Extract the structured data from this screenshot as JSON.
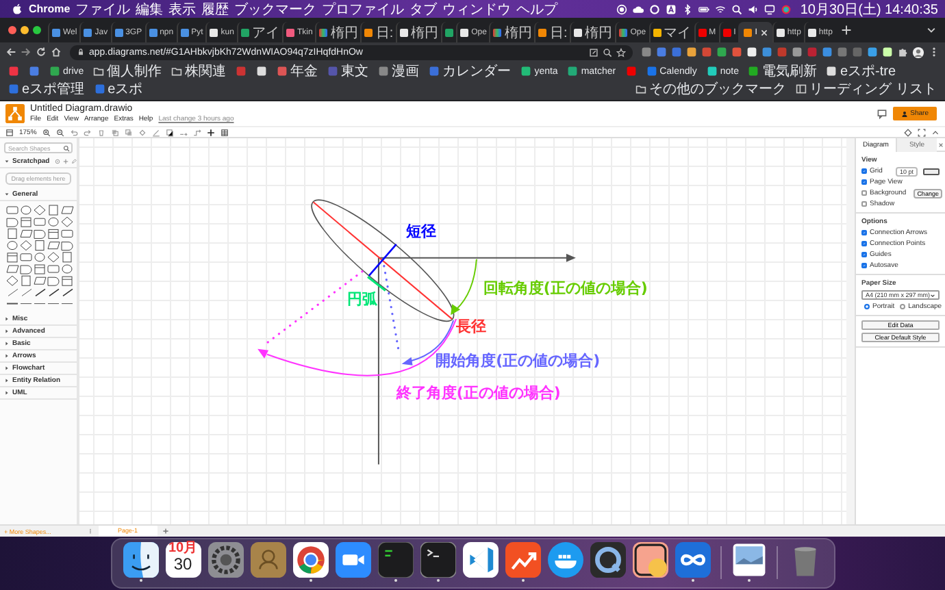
{
  "menu_bar": {
    "app": "Chrome",
    "items": [
      "ファイル",
      "編集",
      "表示",
      "履歴",
      "ブックマーク",
      "プロファイル",
      "タブ",
      "ウィンドウ",
      "ヘルプ"
    ],
    "clock": "10月30日(土) 14:40:35"
  },
  "browser": {
    "tabs": [
      {
        "label": "Wel",
        "selected": false
      },
      {
        "label": "Jav",
        "selected": false
      },
      {
        "label": "3GP",
        "selected": false
      },
      {
        "label": "npn",
        "selected": false
      },
      {
        "label": "Pyt",
        "selected": false
      },
      {
        "label": "kun",
        "selected": false
      },
      {
        "label": "アイ",
        "selected": false
      },
      {
        "label": "Tkin",
        "selected": false
      },
      {
        "label": "楕円",
        "selected": false
      },
      {
        "label": "日:",
        "selected": false
      },
      {
        "label": "楕円",
        "selected": false
      },
      {
        "selected": false
      },
      {
        "label": "Ope",
        "selected": false
      },
      {
        "label": "楕円",
        "selected": false
      },
      {
        "label": "日:",
        "selected": false
      },
      {
        "label": "楕円",
        "selected": false
      },
      {
        "label": "Ope",
        "selected": false
      },
      {
        "label": "マイ",
        "selected": false
      },
      {
        "label": "M",
        "selected": false
      },
      {
        "label": "I",
        "selected": false
      },
      {
        "label": "I",
        "selected": true
      },
      {
        "label": "http",
        "selected": false
      },
      {
        "label": "http",
        "selected": false
      }
    ],
    "address": "app.diagrams.net/#G1AHbkvjbKh72WdnWIAO94q7zIHqfdHnOw",
    "bookmarks": [
      {
        "kind": "site"
      },
      {
        "kind": "site"
      },
      {
        "kind": "site",
        "label": "drive"
      },
      {
        "kind": "folder",
        "label": "個人制作"
      },
      {
        "kind": "folder",
        "label": "株関連"
      },
      {
        "kind": "site"
      },
      {
        "kind": "site"
      },
      {
        "kind": "site",
        "label": "年金"
      },
      {
        "kind": "site",
        "label": "東文"
      },
      {
        "kind": "site",
        "label": "漫画"
      },
      {
        "kind": "site",
        "label": "カレンダー"
      },
      {
        "kind": "site",
        "label": "yenta"
      },
      {
        "kind": "site",
        "label": "matcher"
      },
      {
        "kind": "site"
      },
      {
        "kind": "site",
        "label": "Calendly"
      },
      {
        "kind": "site",
        "label": "note"
      },
      {
        "kind": "site",
        "label": "電気刷新"
      },
      {
        "kind": "site",
        "label": "eスポ-tre"
      },
      {
        "kind": "site",
        "label": "eスポ管理"
      },
      {
        "kind": "site",
        "label": "eスポ"
      }
    ],
    "other_bookmarks": "その他のブックマーク",
    "reading_list": "リーディング リスト"
  },
  "drawio": {
    "title": "Untitled Diagram.drawio",
    "menu": [
      "File",
      "Edit",
      "View",
      "Arrange",
      "Extras",
      "Help"
    ],
    "last_change": "Last change 3 hours ago",
    "share": "Share",
    "zoom": "175%"
  },
  "sidebar": {
    "search_placeholder": "Search Shapes",
    "scratchpad": "Scratchpad",
    "drop_hint": "Drag elements here",
    "sections": [
      {
        "label": "General",
        "expanded": true
      },
      {
        "label": "Misc",
        "expanded": false
      },
      {
        "label": "Advanced",
        "expanded": false
      },
      {
        "label": "Basic",
        "expanded": false
      },
      {
        "label": "Arrows",
        "expanded": false
      },
      {
        "label": "Flowchart",
        "expanded": false
      },
      {
        "label": "Entity Relation",
        "expanded": false
      },
      {
        "label": "UML",
        "expanded": false
      }
    ],
    "more_shapes": "+ More Shapes..."
  },
  "pages": [
    {
      "label": "Page-1",
      "selected": true
    }
  ],
  "format_panel": {
    "tabs": [
      {
        "label": "Diagram",
        "selected": true
      },
      {
        "label": "Style",
        "selected": false
      }
    ],
    "view_title": "View",
    "view": [
      {
        "label": "Grid",
        "checked": true,
        "value": "10 pt"
      },
      {
        "label": "Page View",
        "checked": true
      },
      {
        "label": "Background",
        "checked": false,
        "button": "Change"
      },
      {
        "label": "Shadow",
        "checked": false
      }
    ],
    "options_title": "Options",
    "options": [
      {
        "label": "Connection Arrows",
        "checked": true
      },
      {
        "label": "Connection Points",
        "checked": true
      },
      {
        "label": "Guides",
        "checked": true
      },
      {
        "label": "Autosave",
        "checked": true
      }
    ],
    "paper_title": "Paper Size",
    "paper_size": "A4 (210 mm x 297 mm)",
    "orientations": [
      {
        "label": "Portrait",
        "selected": true
      },
      {
        "label": "Landscape",
        "selected": false
      }
    ],
    "buttons": [
      "Edit Data",
      "Clear Default Style"
    ]
  },
  "diagram": {
    "labels": [
      {
        "text": "短径",
        "color": "#0000ff"
      },
      {
        "text": "回転角度(正の値の場合)",
        "color": "#66cc00"
      },
      {
        "text": "円弧",
        "color": "#00e676"
      },
      {
        "text": "長径",
        "color": "#ff3333"
      },
      {
        "text": "開始角度(正の値の場合)",
        "color": "#6666ff"
      },
      {
        "text": "終了角度(正の値の場合)",
        "color": "#ff33ff"
      }
    ]
  },
  "dock": {
    "apps": [
      {
        "kind": "finder",
        "running": true
      },
      {
        "kind": "calendar",
        "running": false,
        "month": "10月",
        "day": "30"
      },
      {
        "kind": "settings",
        "running": false
      },
      {
        "kind": "contacts",
        "running": false
      },
      {
        "kind": "browser",
        "running": true
      },
      {
        "kind": "video",
        "running": false
      },
      {
        "kind": "monitor",
        "running": true
      },
      {
        "kind": "terminal",
        "running": true
      },
      {
        "kind": "editor",
        "running": false
      },
      {
        "kind": "chart",
        "running": true
      },
      {
        "kind": "whale",
        "running": false
      },
      {
        "kind": "player",
        "running": false
      },
      {
        "kind": "pill",
        "running": false
      },
      {
        "kind": "infinity",
        "running": true
      },
      {
        "kind": "separator"
      },
      {
        "kind": "photo",
        "running": true
      },
      {
        "kind": "separator"
      },
      {
        "kind": "trash",
        "running": false
      }
    ]
  }
}
